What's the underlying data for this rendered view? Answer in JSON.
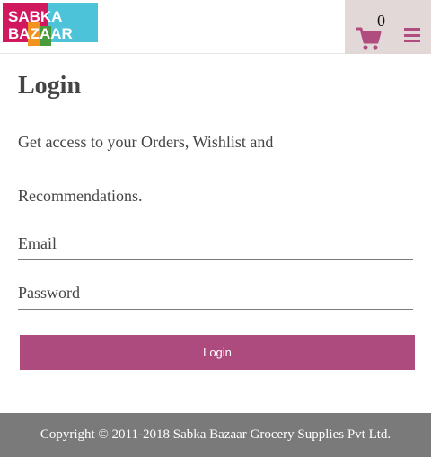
{
  "header": {
    "logo_text_line1": "SABKA",
    "logo_text_line2": "BAZAAR",
    "cart_count": "0",
    "cart_icon": "cart-icon",
    "menu_icon": "hamburger-menu-icon",
    "accent_color": "#ae4b7e"
  },
  "login": {
    "title": "Login",
    "description": "Get access to your Orders, Wishlist and Recommendations.",
    "email_placeholder": "Email",
    "password_placeholder": "Password",
    "submit_label": "Login"
  },
  "footer": {
    "copyright": "Copyright © 2011-2018 Sabka Bazaar Grocery Supplies Pvt Ltd."
  }
}
